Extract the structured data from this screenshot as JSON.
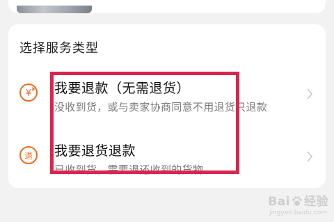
{
  "section": {
    "title": "选择服务类型"
  },
  "options": [
    {
      "icon": "refund-yen-icon",
      "title": "我要退款（无需退货）",
      "description": "没收到货，或与卖家协商同意不用退货只退款"
    },
    {
      "icon": "return-refund-icon",
      "title": "我要退货退款",
      "description": "已收到货，需要退还收到的货物"
    }
  ],
  "watermark": {
    "text_left": "Bai",
    "text_right": "经验",
    "subtext": "jingyan.baidu.com"
  },
  "colors": {
    "accent": "#f06b1d",
    "highlight": "#d9254f"
  }
}
